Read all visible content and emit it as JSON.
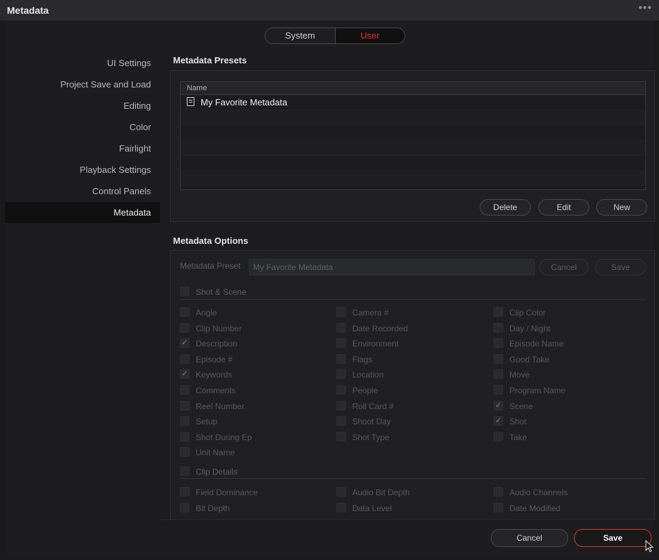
{
  "window": {
    "title": "Metadata",
    "more_icon": "ellipsis-icon"
  },
  "scope_toggle": {
    "system": "System",
    "user": "User",
    "selected": "User"
  },
  "sidebar": {
    "items": [
      {
        "label": "UI Settings"
      },
      {
        "label": "Project Save and Load"
      },
      {
        "label": "Editing"
      },
      {
        "label": "Color"
      },
      {
        "label": "Fairlight"
      },
      {
        "label": "Playback Settings"
      },
      {
        "label": "Control Panels"
      },
      {
        "label": "Metadata",
        "active": true
      }
    ]
  },
  "presets": {
    "title": "Metadata Presets",
    "column_name": "Name",
    "items": [
      "My Favorite Metadata"
    ],
    "buttons": {
      "delete": "Delete",
      "edit": "Edit",
      "new": "New"
    }
  },
  "options": {
    "title": "Metadata Options",
    "preset_label": "Metadata Preset",
    "preset_value": "My Favorite Metadata",
    "cancel": "Cancel",
    "save": "Save",
    "groups": [
      {
        "name": "Shot & Scene",
        "fields": [
          {
            "label": "Angle",
            "checked": false
          },
          {
            "label": "Camera #",
            "checked": false
          },
          {
            "label": "Clip Color",
            "checked": false
          },
          {
            "label": "Clip Number",
            "checked": false
          },
          {
            "label": "Date Recorded",
            "checked": false
          },
          {
            "label": "Day / Night",
            "checked": false
          },
          {
            "label": "Description",
            "checked": true
          },
          {
            "label": "Environment",
            "checked": false
          },
          {
            "label": "Episode Name",
            "checked": false
          },
          {
            "label": "Episode #",
            "checked": false
          },
          {
            "label": "Flags",
            "checked": false
          },
          {
            "label": "Good Take",
            "checked": false
          },
          {
            "label": "Keywords",
            "checked": true
          },
          {
            "label": "Location",
            "checked": false
          },
          {
            "label": "Move",
            "checked": false
          },
          {
            "label": "Comments",
            "checked": false
          },
          {
            "label": "People",
            "checked": false
          },
          {
            "label": "Program Name",
            "checked": false
          },
          {
            "label": "Reel Number",
            "checked": false
          },
          {
            "label": "Roll Card #",
            "checked": false
          },
          {
            "label": "Scene",
            "checked": true
          },
          {
            "label": "Setup",
            "checked": false
          },
          {
            "label": "Shoot Day",
            "checked": false
          },
          {
            "label": "Shot",
            "checked": true
          },
          {
            "label": "Shot During Ep",
            "checked": false
          },
          {
            "label": "Shot Type",
            "checked": false
          },
          {
            "label": "Take",
            "checked": false
          },
          {
            "label": "Unit Name",
            "checked": false
          }
        ]
      },
      {
        "name": "Clip Details",
        "fields": [
          {
            "label": "Field Dominance",
            "checked": false
          },
          {
            "label": "Audio Bit Depth",
            "checked": false
          },
          {
            "label": "Audio Channels",
            "checked": false
          },
          {
            "label": "Bit Depth",
            "checked": false
          },
          {
            "label": "Data Level",
            "checked": false
          },
          {
            "label": "Date Modified",
            "checked": false
          }
        ]
      }
    ]
  },
  "footer": {
    "cancel": "Cancel",
    "save": "Save"
  }
}
